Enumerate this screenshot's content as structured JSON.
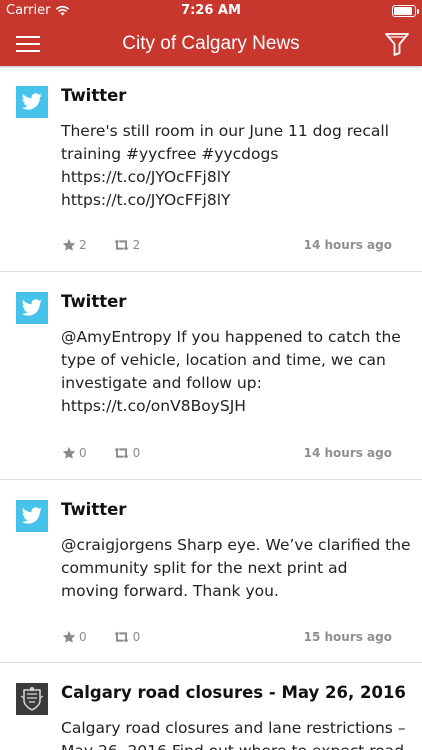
{
  "status_bar": {
    "carrier": "Carrier",
    "time": "7:26 AM"
  },
  "nav": {
    "title": "City of Calgary News"
  },
  "feed": [
    {
      "source": "Twitter",
      "lines": [
        "There's still room in our June 11 dog recall",
        "training #yycfree #yycdogs",
        "https://t.co/JYOcFFj8lY",
        "https://t.co/JYOcFFj8lY"
      ],
      "favorites": "2",
      "retweets": "2",
      "time": "14 hours ago"
    },
    {
      "source": "Twitter",
      "lines": [
        "@AmyEntropy If you happened to catch the",
        "type of vehicle, location and time, we can",
        "investigate and follow up:",
        "https://t.co/onV8BoySJH"
      ],
      "favorites": "0",
      "retweets": "0",
      "time": "14 hours ago"
    },
    {
      "source": "Twitter",
      "lines": [
        "@craigjorgens Sharp eye. We’ve clarified the",
        "community split for the next print ad",
        "moving forward. Thank you."
      ],
      "favorites": "0",
      "retweets": "0",
      "time": "15 hours ago"
    },
    {
      "source": "Calgary road closures - May 26, 2016",
      "lines": [
        "Calgary road closures and lane restrictions –",
        "May 26, 2016 Find out where to expect road"
      ]
    }
  ],
  "colors": {
    "header": "#c8372d",
    "twitter": "#45c3ea",
    "meta_text": "#8a8a8a"
  },
  "icons": {
    "menu": "hamburger-icon",
    "filter": "funnel-icon",
    "source_twitter": "twitter-bird-icon",
    "source_city": "city-crest-icon",
    "favorite": "star-icon",
    "retweet": "retweet-icon"
  }
}
